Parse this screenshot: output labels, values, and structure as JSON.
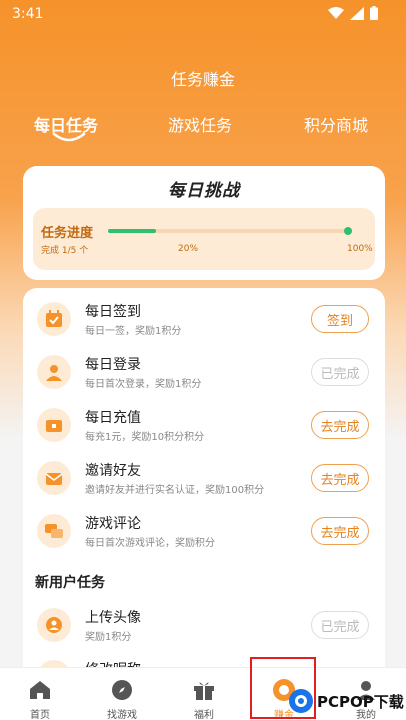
{
  "status": {
    "time": "3:41"
  },
  "header": {
    "title": "任务赚金"
  },
  "tabs": [
    {
      "label": "每日任务",
      "active": true
    },
    {
      "label": "游戏任务",
      "active": false
    },
    {
      "label": "积分商城",
      "active": false
    }
  ],
  "challenge": {
    "title": "每日挑战",
    "progress_label": "任务进度",
    "progress_sub": "完成 1/5 个",
    "progress_fraction": 0.2,
    "tick_mid": "20%",
    "tick_end": "100%"
  },
  "tasks": [
    {
      "name": "每日签到",
      "desc": "每日一签，奖励1积分",
      "button": "签到",
      "done": false,
      "icon": "calendar-check-icon"
    },
    {
      "name": "每日登录",
      "desc": "每日首次登录，奖励1积分",
      "button": "已完成",
      "done": true,
      "icon": "user-icon"
    },
    {
      "name": "每日充值",
      "desc": "每充1元，奖励10积分积分",
      "button": "去完成",
      "done": false,
      "icon": "wallet-icon"
    },
    {
      "name": "邀请好友",
      "desc": "邀请好友并进行实名认证，奖励100积分",
      "button": "去完成",
      "done": false,
      "icon": "envelope-icon"
    },
    {
      "name": "游戏评论",
      "desc": "每日首次游戏评论，奖励积分",
      "button": "去完成",
      "done": false,
      "icon": "comment-icon"
    }
  ],
  "new_user": {
    "title": "新用户任务",
    "tasks": [
      {
        "name": "上传头像",
        "desc": "奖励1积分",
        "button": "已完成",
        "done": true,
        "icon": "avatar-upload-icon"
      },
      {
        "name": "修改昵称",
        "desc": "",
        "button": "",
        "done": true,
        "icon": "edit-icon"
      }
    ]
  },
  "nav": [
    {
      "label": "首页",
      "icon": "home-icon"
    },
    {
      "label": "找游戏",
      "icon": "compass-icon"
    },
    {
      "label": "福利",
      "icon": "gift-icon"
    },
    {
      "label": "赚金",
      "icon": "coin-icon"
    },
    {
      "label": "我的",
      "icon": "profile-icon"
    }
  ],
  "watermark": {
    "text": "PCPOP下载"
  },
  "colors": {
    "accent": "#f6922a",
    "progress": "#2fbf6f"
  }
}
